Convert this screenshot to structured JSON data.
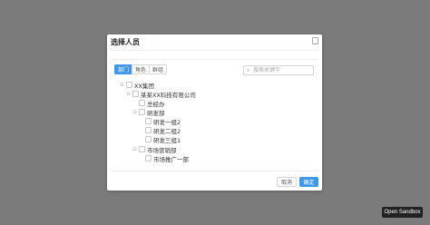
{
  "modal": {
    "title": "选择人员",
    "close_icon": "close-icon"
  },
  "tabs": [
    {
      "label": "部门",
      "active": true
    },
    {
      "label": "角色",
      "active": false
    },
    {
      "label": "群组",
      "active": false
    }
  ],
  "search": {
    "icon": "search-icon",
    "placeholder": "搜索关键字"
  },
  "tree": {
    "nodes": [
      {
        "label": "XX集团",
        "toggle": "⊟",
        "level": 0
      },
      {
        "label": "某某XX科技有限公司",
        "toggle": "⊟",
        "level": 1
      },
      {
        "label": "总经办",
        "toggle": "",
        "level": 2
      },
      {
        "label": "研发部",
        "toggle": "⊟",
        "level": 2
      },
      {
        "label": "研发一组2",
        "toggle": "",
        "level": 3
      },
      {
        "label": "研发二组2",
        "toggle": "",
        "level": 3
      },
      {
        "label": "研发三组1",
        "toggle": "",
        "level": 3
      },
      {
        "label": "市场营销部",
        "toggle": "⊟",
        "level": 2
      },
      {
        "label": "市场推广一部",
        "toggle": "",
        "level": 3
      }
    ]
  },
  "footer": {
    "cancel_label": "取消",
    "ok_label": "确定"
  },
  "sandbox_button": "Open Sandbox",
  "colors": {
    "accent": "#3f97e5",
    "overlay": "#7b7b7b"
  }
}
